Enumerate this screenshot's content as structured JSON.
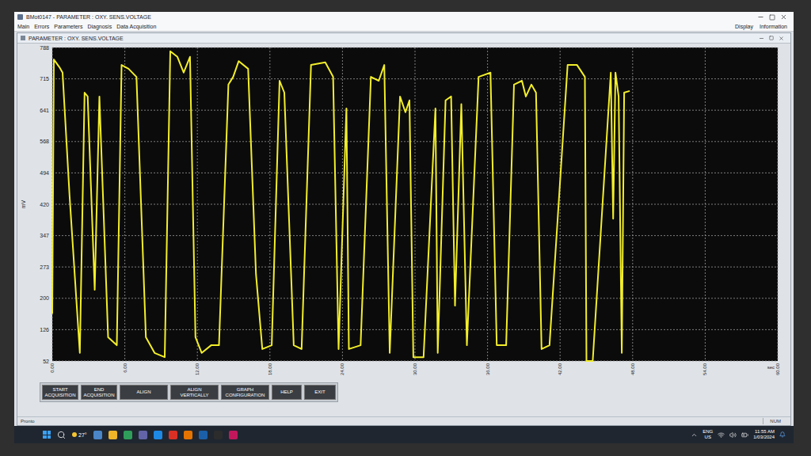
{
  "window": {
    "title": "BMot0147 - PARAMETER : OXY. SENS.VOLTAGE"
  },
  "menu": {
    "left": [
      "Main",
      "Errors",
      "Parameters",
      "Diagnosis",
      "Data Acquisition"
    ],
    "right": [
      "Display",
      "Information"
    ]
  },
  "child_window": {
    "title": "PARAMETER : OXY. SENS.VOLTAGE"
  },
  "chart": {
    "y_unit": "mV",
    "x_unit": "sec",
    "y_ticks": [
      "52",
      "126",
      "200",
      "273",
      "347",
      "420",
      "494",
      "568",
      "641",
      "715",
      "788"
    ],
    "x_ticks": [
      "0.00",
      "6.00",
      "12.00",
      "18.00",
      "24.00",
      "30.00",
      "36.00",
      "42.00",
      "48.00",
      "54.00",
      "60.00"
    ],
    "series": [
      {
        "name": "OXY. SENS.VOLTAGE",
        "points": [
          [
            0,
            163
          ],
          [
            0.13,
            760
          ],
          [
            0.59,
            742
          ],
          [
            0.85,
            729
          ],
          [
            1.43,
            441
          ],
          [
            2.28,
            71
          ],
          [
            2.67,
            682
          ],
          [
            2.93,
            673
          ],
          [
            3.51,
            219
          ],
          [
            3.9,
            673
          ],
          [
            4.62,
            108
          ],
          [
            5.34,
            89
          ],
          [
            5.73,
            747
          ],
          [
            6.31,
            738
          ],
          [
            6.96,
            719
          ],
          [
            7.74,
            108
          ],
          [
            8.46,
            71
          ],
          [
            9.3,
            61
          ],
          [
            9.76,
            779
          ],
          [
            10.35,
            766
          ],
          [
            10.87,
            729
          ],
          [
            11.39,
            766
          ],
          [
            11.84,
            108
          ],
          [
            12.36,
            71
          ],
          [
            13.14,
            89
          ],
          [
            13.79,
            89
          ],
          [
            14.57,
            701
          ],
          [
            14.96,
            719
          ],
          [
            15.42,
            756
          ],
          [
            16.2,
            738
          ],
          [
            16.85,
            256
          ],
          [
            17.37,
            80
          ],
          [
            18.15,
            89
          ],
          [
            18.8,
            710
          ],
          [
            19.19,
            682
          ],
          [
            19.97,
            89
          ],
          [
            20.62,
            80
          ],
          [
            21.4,
            747
          ],
          [
            22.58,
            753
          ],
          [
            23.23,
            719
          ],
          [
            23.68,
            80
          ],
          [
            24.33,
            645
          ],
          [
            24.53,
            80
          ],
          [
            25.5,
            89
          ],
          [
            26.35,
            719
          ],
          [
            27,
            710
          ],
          [
            27.46,
            747
          ],
          [
            27.91,
            71
          ],
          [
            28.76,
            673
          ],
          [
            29.21,
            636
          ],
          [
            29.54,
            664
          ],
          [
            29.86,
            61
          ],
          [
            30.71,
            61
          ],
          [
            31.69,
            645
          ],
          [
            31.88,
            71
          ],
          [
            32.53,
            664
          ],
          [
            32.99,
            673
          ],
          [
            33.31,
            182
          ],
          [
            33.83,
            655
          ],
          [
            34.29,
            89
          ],
          [
            35.26,
            719
          ],
          [
            36.24,
            729
          ],
          [
            36.76,
            89
          ],
          [
            37.54,
            89
          ],
          [
            38.19,
            701
          ],
          [
            38.84,
            710
          ],
          [
            39.17,
            673
          ],
          [
            39.62,
            701
          ],
          [
            40.01,
            682
          ],
          [
            40.47,
            80
          ],
          [
            41.12,
            89
          ],
          [
            42.62,
            747
          ],
          [
            43.4,
            747
          ],
          [
            44.05,
            719
          ],
          [
            44.18,
            52
          ],
          [
            44.7,
            52
          ],
          [
            46.19,
            729
          ],
          [
            46.39,
            386
          ],
          [
            46.58,
            729
          ],
          [
            46.84,
            673
          ],
          [
            47.1,
            71
          ],
          [
            47.3,
            682
          ],
          [
            47.76,
            686
          ]
        ]
      }
    ]
  },
  "buttons": [
    "START ACQUISITION",
    "END ACQUISITION",
    "ALIGN",
    "ALIGN VERTICALLY",
    "GRAPH CONFIGURATION",
    "HELP",
    "EXIT"
  ],
  "status_bar": {
    "left": "Pronto",
    "right": "NUM"
  },
  "taskbar": {
    "weather": "27°",
    "language": "ENG",
    "region": "US",
    "time": "11:55 AM",
    "date": "1/03/2024"
  }
}
